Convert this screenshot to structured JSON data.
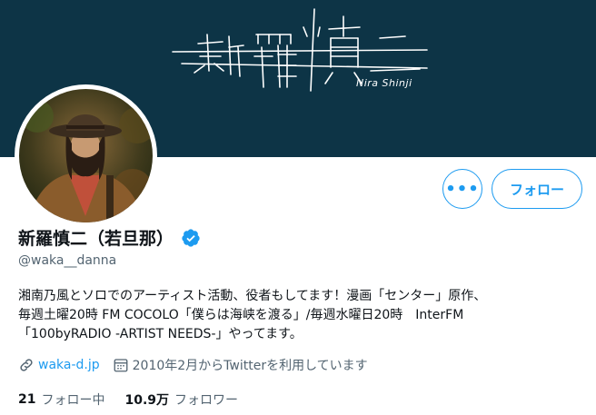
{
  "banner": {
    "title": "新羅慎二",
    "subtitle": "Nira Shinji",
    "background": "#0d3446"
  },
  "profile": {
    "display_name": "新羅慎二（若旦那）",
    "handle": "@waka__danna",
    "verified_icon": "verified-badge-icon",
    "bio_lines": [
      "湘南乃風とソロでのアーティスト活動、役者もしてます！漫画「センター」原作、",
      "毎週土曜20時 FM COCOLO「僕らは海峡を渡る」/毎週水曜日20時　InterFM",
      "「100byRADIO -ARTIST NEEDS-」やってます。"
    ],
    "link_text": "waka-d.jp",
    "joined_text": "2010年2月からTwitterを利用しています"
  },
  "actions": {
    "more_label": "•••",
    "follow_label": "フォロー"
  },
  "stats": {
    "following_count": "21",
    "following_label": "フォロー中",
    "followers_count": "10.9万",
    "followers_label": "フォロワー"
  },
  "colors": {
    "accent": "#1d9bf0",
    "text": "#0f1419",
    "secondary": "#536471"
  }
}
